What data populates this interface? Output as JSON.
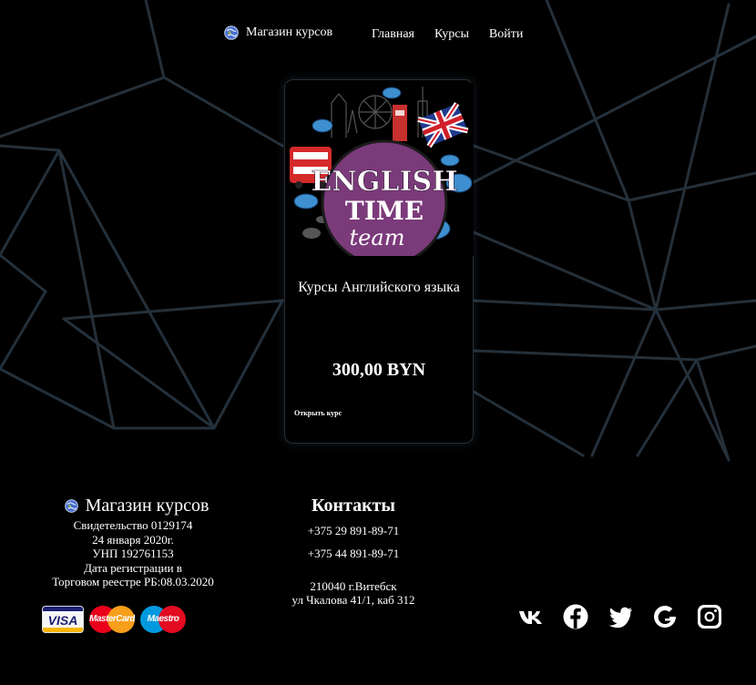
{
  "nav": {
    "brand": "Магазин курсов",
    "links": [
      "Главная",
      "Курсы",
      "Войти"
    ]
  },
  "course_card": {
    "image_logo": {
      "line1": "ENGLISH",
      "line2": "TIME",
      "line3": "team"
    },
    "title": "Курсы Английского языка",
    "price": "300,00 BYN",
    "open_link": "Открыть курс"
  },
  "footer": {
    "brand": "Магазин курсов",
    "info_lines": [
      "Свидетельство 0129174",
      "24 января 2020г.",
      "УНП 192761153",
      "Дата регистрации в",
      "Торговом реестре РБ:08.03.2020"
    ],
    "payment_cards": [
      "VISA",
      "MasterCard",
      "Maestro"
    ],
    "contacts": {
      "title": "Контакты",
      "phones": [
        "+375 29 891-89-71",
        "+375 44 891-89-71"
      ],
      "address_line1": "210040 г.Витебск",
      "address_line2": "ул Чкалова 41/1, каб 312"
    },
    "socials": [
      "vk-icon",
      "facebook-icon",
      "twitter-icon",
      "google-icon",
      "instagram-icon"
    ]
  },
  "colors": {
    "background": "#000000",
    "bg_lines": "#26323a",
    "logo_circle": "#7b3a7a",
    "cloud_blue": "#3d8fd0",
    "bus_red": "#d42a2a"
  }
}
